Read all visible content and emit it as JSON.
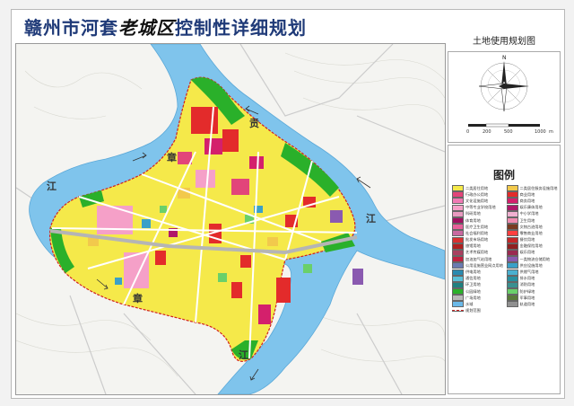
{
  "title": {
    "prefix": "赣州市河套",
    "accent": "老城区",
    "suffix": "控制性详细规划"
  },
  "subtitle": "土地使用规划图",
  "river_labels": [
    "章",
    "贡",
    "江",
    "江",
    "章",
    "江"
  ],
  "compass": {
    "note": "",
    "scale_ticks": [
      "0",
      "200",
      "500",
      "1000"
    ],
    "scale_unit": "m"
  },
  "legend": {
    "title": "图例",
    "items": [
      {
        "label": "二类居住用地",
        "color": "#f5e94a"
      },
      {
        "label": "二类居住服务设施用地",
        "color": "#f2c94c"
      },
      {
        "label": "行政办公用地",
        "color": "#e2457a"
      },
      {
        "label": "商业用地",
        "color": "#e32b2b"
      },
      {
        "label": "文化设施用地",
        "color": "#f07ab4"
      },
      {
        "label": "商务用地",
        "color": "#d4206c"
      },
      {
        "label": "中等专业学校用地",
        "color": "#f5a0c8"
      },
      {
        "label": "娱乐康体用地",
        "color": "#b0186a"
      },
      {
        "label": "科研用地",
        "color": "#e89ac0"
      },
      {
        "label": "中小学用地",
        "color": "#f0b0d0"
      },
      {
        "label": "体育用地",
        "color": "#a01060"
      },
      {
        "label": "卫生用地",
        "color": "#f08cb0"
      },
      {
        "label": "医疗卫生用地",
        "color": "#e6609a"
      },
      {
        "label": "文物古迹用地",
        "color": "#7a3a20"
      },
      {
        "label": "社会福利用地",
        "color": "#c86aa0"
      },
      {
        "label": "零售商业用地",
        "color": "#ff4040"
      },
      {
        "label": "批发市场用地",
        "color": "#d83030"
      },
      {
        "label": "餐饮用地",
        "color": "#c42828"
      },
      {
        "label": "旅馆用地",
        "color": "#b02020"
      },
      {
        "label": "金融保险用地",
        "color": "#902020"
      },
      {
        "label": "艺术传媒用地",
        "color": "#a84060"
      },
      {
        "label": "娱乐用地",
        "color": "#9a2a50"
      },
      {
        "label": "加油加气站用地",
        "color": "#c02040"
      },
      {
        "label": "一类物流仓储用地",
        "color": "#8a5ab0"
      },
      {
        "label": "公用设施营业网点用地",
        "color": "#6a7ab0"
      },
      {
        "label": "供应设施用地",
        "color": "#3aa0c8"
      },
      {
        "label": "供电用地",
        "color": "#2a8ab0"
      },
      {
        "label": "供燃气用地",
        "color": "#4ab0d0"
      },
      {
        "label": "通信用地",
        "color": "#5ac0d8"
      },
      {
        "label": "排水用地",
        "color": "#2890a0"
      },
      {
        "label": "环卫用地",
        "color": "#208080"
      },
      {
        "label": "消防用地",
        "color": "#3a9090"
      },
      {
        "label": "公园绿地",
        "color": "#2ab02a"
      },
      {
        "label": "防护绿地",
        "color": "#6ad06a"
      },
      {
        "label": "广场用地",
        "color": "#b8b8b8"
      },
      {
        "label": "军事用地",
        "color": "#5a7a3a"
      },
      {
        "label": "水域",
        "color": "#6ab8e8"
      },
      {
        "label": "轨道用地",
        "color": "#909090"
      },
      {
        "label": "规划范围",
        "color": "#ffffff"
      },
      {
        "label": "",
        "color": "#ffffff"
      }
    ]
  },
  "colors": {
    "river": "#7fc4ec",
    "residential": "#f5e94a",
    "commercial": "#e32b2b",
    "admin": "#e2457a",
    "green": "#2ab02a",
    "road": "#ffffff",
    "pink_zone": "#f5a0c8",
    "magenta": "#d4206c",
    "purple": "#8a5ab0",
    "cyan": "#3aa0c8",
    "boundary": "#d12020"
  }
}
